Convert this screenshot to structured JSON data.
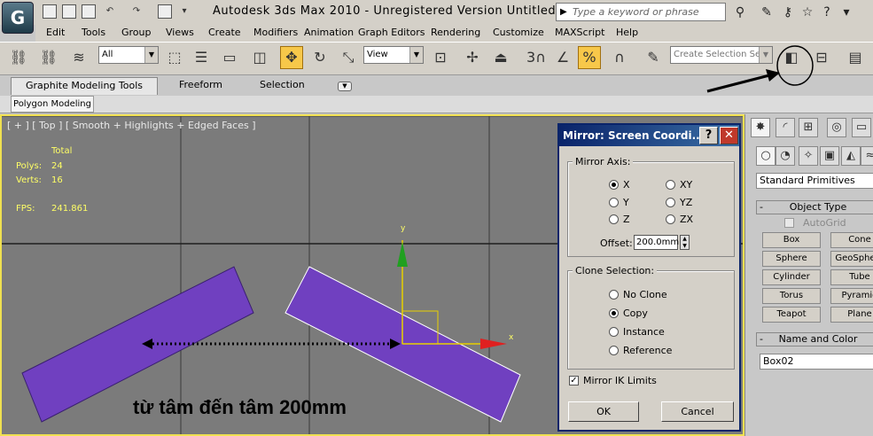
{
  "app": {
    "title": "Autodesk 3ds Max  2010  - Unregistered Version   Untitled",
    "search_placeholder": "Type a keyword or phrase"
  },
  "menu": [
    "Edit",
    "Tools",
    "Group",
    "Views",
    "Create",
    "Modifiers",
    "Animation",
    "Graph Editors",
    "Rendering",
    "Customize",
    "MAXScript",
    "Help"
  ],
  "toolbar": {
    "filter_value": "All",
    "refcoord_value": "View",
    "selection_set_placeholder": "Create Selection Se",
    "snap_label": "3"
  },
  "ribbon": {
    "tabs": [
      "Graphite Modeling Tools",
      "Freeform",
      "Selection"
    ],
    "subtab": "Polygon Modeling"
  },
  "viewport": {
    "label": "[ + ] [ Top ] [ Smooth + Highlights + Edged Faces ]",
    "stats": {
      "total_label": "Total",
      "polys_label": "Polys:",
      "polys_value": "24",
      "verts_label": "Verts:",
      "verts_value": "16",
      "fps_label": "FPS:",
      "fps_value": "241.861"
    },
    "axis_x": "x",
    "axis_y": "y",
    "caption": "từ tâm đến tâm 200mm"
  },
  "dialog": {
    "title": "Mirror: Screen Coordi...",
    "help_button": "?",
    "close_button": "✕",
    "mirror_axis": {
      "title": "Mirror Axis:",
      "options": [
        "X",
        "Y",
        "Z",
        "XY",
        "YZ",
        "ZX"
      ],
      "selected": "X",
      "offset_label": "Offset:",
      "offset_value": "200.0mm"
    },
    "clone_selection": {
      "title": "Clone Selection:",
      "options": [
        "No Clone",
        "Copy",
        "Instance",
        "Reference"
      ],
      "selected": "Copy"
    },
    "mirror_ik_label": "Mirror IK Limits",
    "mirror_ik_checked": true,
    "ok_label": "OK",
    "cancel_label": "Cancel"
  },
  "command_panel": {
    "category_value": "Standard Primitives",
    "object_type_title": "Object Type",
    "autogrid_label": "AutoGrid",
    "buttons": [
      "Box",
      "Cone",
      "Sphere",
      "GeoSphere",
      "Cylinder",
      "Tube",
      "Torus",
      "Pyramid",
      "Teapot",
      "Plane"
    ],
    "name_color_title": "Name and Color",
    "name_value": "Box02"
  },
  "colors": {
    "object_fill": "#7040c0",
    "viewport_bg": "#7b7b7b",
    "active_border": "#f0e050",
    "dialog_title": "#0a246a"
  }
}
